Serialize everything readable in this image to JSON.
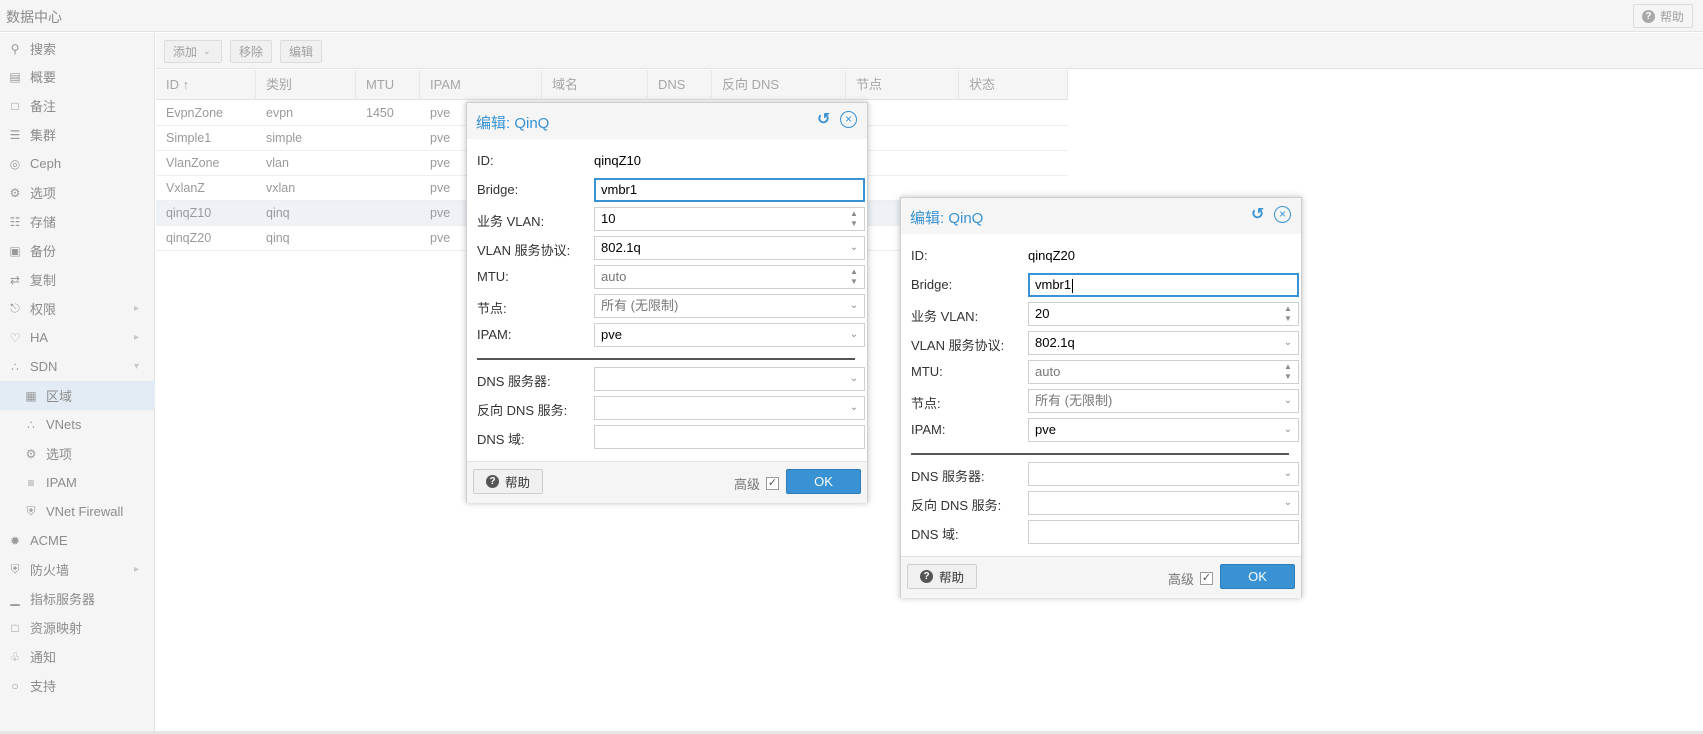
{
  "topbar": {
    "title": "数据中心",
    "help_label": "帮助"
  },
  "sidebar": {
    "items": [
      {
        "label": "搜索",
        "icon": "search-icon"
      },
      {
        "label": "概要",
        "icon": "book-icon"
      },
      {
        "label": "备注",
        "icon": "note-icon"
      },
      {
        "label": "集群",
        "icon": "server-icon"
      },
      {
        "label": "Ceph",
        "icon": "ceph-icon"
      },
      {
        "label": "选项",
        "icon": "gear-icon"
      },
      {
        "label": "存储",
        "icon": "database-icon"
      },
      {
        "label": "备份",
        "icon": "floppy-icon"
      },
      {
        "label": "复制",
        "icon": "retweet-icon"
      },
      {
        "label": "权限",
        "icon": "unlock-icon"
      },
      {
        "label": "HA",
        "icon": "heartbeat-icon"
      },
      {
        "label": "SDN",
        "icon": "sdn-icon"
      },
      {
        "label": "区域",
        "icon": "grid-icon"
      },
      {
        "label": "VNets",
        "icon": "vnets-icon"
      },
      {
        "label": "选项",
        "icon": "gear-icon"
      },
      {
        "label": "IPAM",
        "icon": "ipam-icon"
      },
      {
        "label": "VNet Firewall",
        "icon": "shield-icon"
      },
      {
        "label": "ACME",
        "icon": "certificate-icon"
      },
      {
        "label": "防火墙",
        "icon": "shield-icon"
      },
      {
        "label": "指标服务器",
        "icon": "bar-chart-icon"
      },
      {
        "label": "资源映射",
        "icon": "folder-icon"
      },
      {
        "label": "通知",
        "icon": "bell-icon"
      },
      {
        "label": "支持",
        "icon": "comments-icon"
      }
    ]
  },
  "toolbar": {
    "add": "添加",
    "remove": "移除",
    "edit": "编辑"
  },
  "grid": {
    "columns": [
      "ID ↑",
      "类别",
      "MTU",
      "IPAM",
      "域名",
      "DNS",
      "反向 DNS",
      "节点",
      "状态"
    ],
    "rows": [
      {
        "id": "EvpnZone",
        "type": "evpn",
        "mtu": "1450",
        "ipam": "pve"
      },
      {
        "id": "Simple1",
        "type": "simple",
        "mtu": "",
        "ipam": "pve"
      },
      {
        "id": "VlanZone",
        "type": "vlan",
        "mtu": "",
        "ipam": "pve"
      },
      {
        "id": "VxlanZ",
        "type": "vxlan",
        "mtu": "",
        "ipam": "pve"
      },
      {
        "id": "qinqZ10",
        "type": "qinq",
        "mtu": "",
        "ipam": "pve"
      },
      {
        "id": "qinqZ20",
        "type": "qinq",
        "mtu": "",
        "ipam": "pve"
      }
    ]
  },
  "dialogs": [
    {
      "title": "编辑: QinQ",
      "labels": {
        "id": "ID:",
        "bridge": "Bridge:",
        "vlan": "业务 VLAN:",
        "protocol": "VLAN 服务协议:",
        "mtu": "MTU:",
        "nodes": "节点:",
        "ipam": "IPAM:",
        "dns": "DNS 服务器:",
        "reverse_dns": "反向 DNS 服务:",
        "dns_zone": "DNS 域:"
      },
      "values": {
        "id": "qinqZ10",
        "bridge": "vmbr1",
        "vlan": "10",
        "protocol": "802.1q",
        "mtu": "auto",
        "nodes": "所有 (无限制)",
        "ipam": "pve",
        "dns": "",
        "reverse_dns": "",
        "dns_zone": ""
      },
      "help": "帮助",
      "advanced": "高级",
      "ok": "OK"
    },
    {
      "title": "编辑: QinQ",
      "labels": {
        "id": "ID:",
        "bridge": "Bridge:",
        "vlan": "业务 VLAN:",
        "protocol": "VLAN 服务协议:",
        "mtu": "MTU:",
        "nodes": "节点:",
        "ipam": "IPAM:",
        "dns": "DNS 服务器:",
        "reverse_dns": "反向 DNS 服务:",
        "dns_zone": "DNS 域:"
      },
      "values": {
        "id": "qinqZ20",
        "bridge": "vmbr1",
        "vlan": "20",
        "protocol": "802.1q",
        "mtu": "auto",
        "nodes": "所有 (无限制)",
        "ipam": "pve",
        "dns": "",
        "reverse_dns": "",
        "dns_zone": ""
      },
      "help": "帮助",
      "advanced": "高级",
      "ok": "OK"
    }
  ],
  "colors": {
    "accent": "#3892d4",
    "selected_row": "#eef2f7",
    "panel_bg": "#f5f5f5"
  }
}
